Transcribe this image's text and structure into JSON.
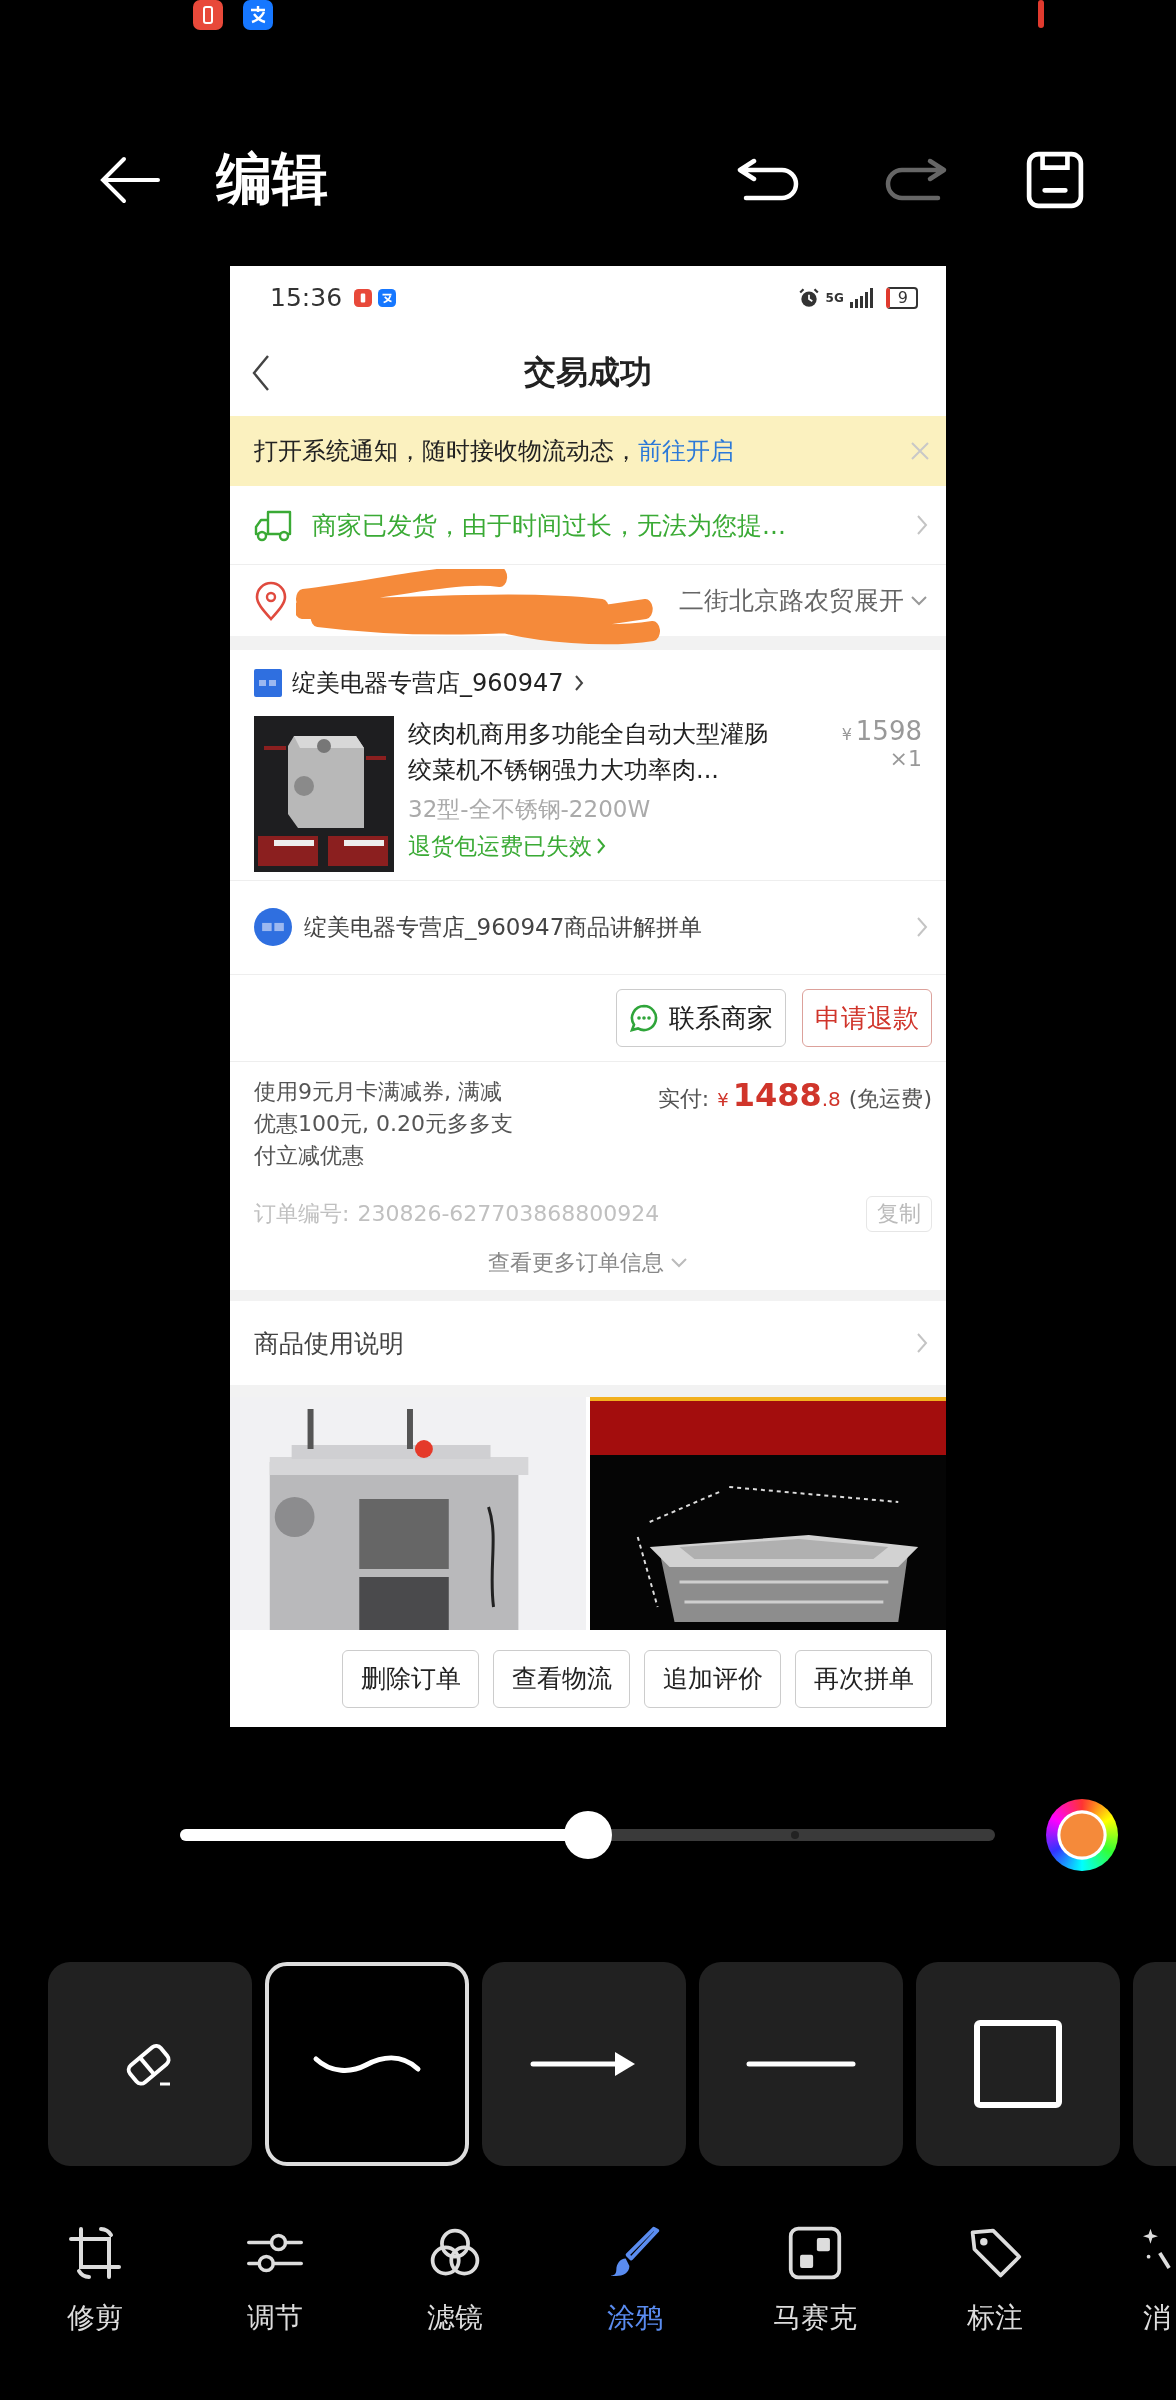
{
  "header": {
    "title": "编辑",
    "undo": {
      "disabled": false
    },
    "redo": {
      "disabled": true
    }
  },
  "screenshot": {
    "status_bar": {
      "time": "15:36",
      "network": "5G",
      "battery": "9"
    },
    "title": "交易成功",
    "notice": {
      "text": "打开系统通知，随时接收物流动态，",
      "link": "前往开启"
    },
    "shipping": "商家已发货，由于时间过长，无法为您提...",
    "address": {
      "text": "二街北京路农贸",
      "expand": "展开"
    },
    "store": {
      "name": "绽美电器专营店_960947"
    },
    "product": {
      "title": "绞肉机商用多功能全自动大型灌肠绞菜机不锈钢强力大功率肉...",
      "currency": "¥",
      "price": "1598",
      "quantity": "×1",
      "variant": "32型-全不锈钢-2200W",
      "return_note": "退货包运费已失效"
    },
    "group_row": "绽美电器专营店_960947商品讲解拼单",
    "actions": [
      {
        "label": "联系商家",
        "kind": "chat"
      },
      {
        "label": "申请退款",
        "kind": "refund"
      }
    ],
    "payment": {
      "note": "使用9元月卡满减券, 满减优惠100元, 0.20元多多支付立减优惠",
      "label": "实付:",
      "currency": "¥",
      "amount": "1488",
      "decimal": ".8",
      "shipping": "(免运费)"
    },
    "order": {
      "label": "订单编号:",
      "number": "230826-627703868800924",
      "copy": "复制",
      "more": "查看更多订单信息"
    },
    "usage": "商品使用说明",
    "bottom_buttons": [
      "删除订单",
      "查看物流",
      "追加评价",
      "再次拼单"
    ]
  },
  "brush": {
    "level": 0.5
  },
  "tools": [
    {
      "kind": "eraser",
      "selected": false
    },
    {
      "kind": "freehand",
      "selected": true
    },
    {
      "kind": "arrow",
      "selected": false
    },
    {
      "kind": "line",
      "selected": false
    },
    {
      "kind": "rectangle",
      "selected": false
    },
    {
      "kind": "blank",
      "selected": false
    }
  ],
  "nav": [
    {
      "label": "修剪",
      "kind": "crop",
      "selected": false
    },
    {
      "label": "调节",
      "kind": "adjust",
      "selected": false
    },
    {
      "label": "滤镜",
      "kind": "filter",
      "selected": false
    },
    {
      "label": "涂鸦",
      "kind": "brush",
      "selected": true
    },
    {
      "label": "马赛克",
      "kind": "mosaic",
      "selected": false
    },
    {
      "label": "标注",
      "kind": "tag",
      "selected": false
    },
    {
      "label": "消",
      "kind": "magic",
      "selected": false
    }
  ]
}
